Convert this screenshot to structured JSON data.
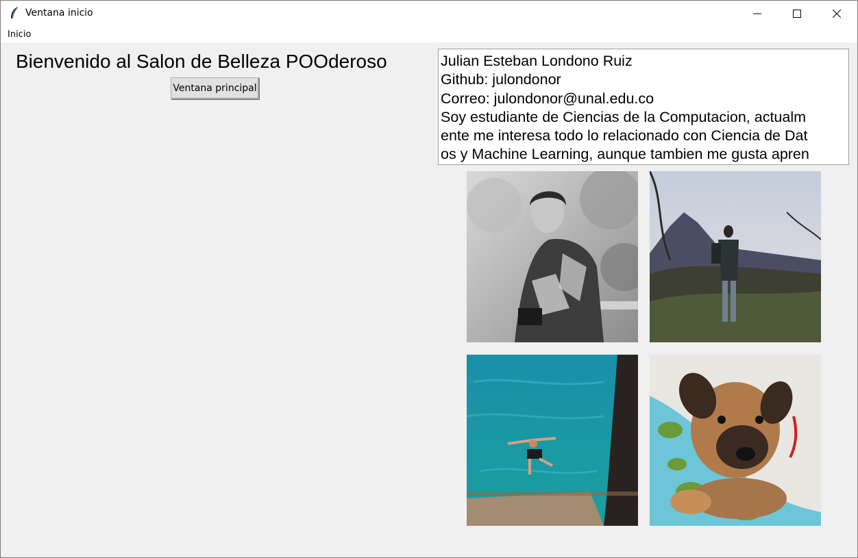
{
  "window": {
    "title": "Ventana inicio",
    "icon": "feather-icon",
    "controls": [
      "minimize-icon",
      "maximize-icon",
      "close-icon"
    ]
  },
  "menu": {
    "items": [
      {
        "label": "Inicio"
      }
    ]
  },
  "left_panel": {
    "welcome": "Bienvenido al Salon de Belleza POOderoso",
    "main_button": "Ventana principal"
  },
  "info": {
    "lines": [
      "Julian Esteban Londono Ruiz",
      "Github: julondonor",
      "Correo: julondonor@unal.edu.co",
      "Soy estudiante de Ciencias de la Computacion, actualm",
      "ente me interesa todo lo relacionado con Ciencia de Dat",
      "os y Machine Learning, aunque tambien me gusta apren"
    ]
  },
  "photos": [
    "portrait-photo",
    "hiking-photo",
    "swimming-photo",
    "puppy-photo"
  ],
  "colors": {
    "window_bg": "#f0f0f0",
    "titlebar_bg": "#ffffff",
    "button_bg": "#e1e1e1"
  }
}
